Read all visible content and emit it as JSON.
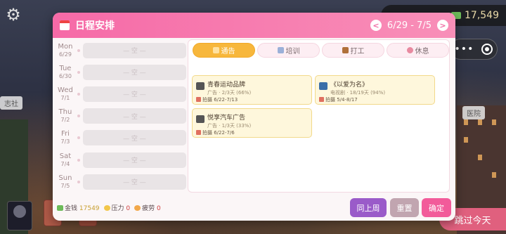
{
  "hud": {
    "money_top": "17,549"
  },
  "side_labels": {
    "left": "志社",
    "right": "医院"
  },
  "skip_button": "跳过今天",
  "dialog": {
    "title": "日程安排",
    "range": "6/29 - 7/5",
    "prev_arrow": "<",
    "next_arrow": ">",
    "days": [
      {
        "name": "Mon",
        "date": "6/29",
        "slot": "— 空 —"
      },
      {
        "name": "Tue",
        "date": "6/30",
        "slot": "— 空 —"
      },
      {
        "name": "Wed",
        "date": "7/1",
        "slot": "— 空 —"
      },
      {
        "name": "Thu",
        "date": "7/2",
        "slot": "— 空 —"
      },
      {
        "name": "Fri",
        "date": "7/3",
        "slot": "— 空 —"
      },
      {
        "name": "Sat",
        "date": "7/4",
        "slot": "— 空 —"
      },
      {
        "name": "Sun",
        "date": "7/5",
        "slot": "— 空 —"
      }
    ],
    "tabs": [
      {
        "label": "通告",
        "active": true,
        "icon_color": "#ffe1a0"
      },
      {
        "label": "培训",
        "active": false,
        "icon_color": "#9bb0d8"
      },
      {
        "label": "打工",
        "active": false,
        "icon_color": "#b0703a"
      },
      {
        "label": "休息",
        "active": false,
        "icon_color": "#e88aa0"
      }
    ],
    "cards": [
      {
        "name": "青春运动品牌",
        "meta": "广告 · 2/3天 (66%)",
        "date": "拍摄 6/22-7/13",
        "icon": "camera-icon"
      },
      {
        "name": "《以爱为名》",
        "meta": "电视剧 · 18/19天 (94%)",
        "date": "拍摄 5/4-8/17",
        "icon": "tv-icon"
      },
      {
        "name": "悦享汽车广告",
        "meta": "广告 · 1/3天 (33%)",
        "date": "拍摄 6/22-7/6",
        "icon": "camera-icon"
      }
    ],
    "stats": {
      "money_label": "金钱",
      "money_value": "17549",
      "stress_label": "压力",
      "stress_value": "0",
      "fatigue_label": "疲劳",
      "fatigue_value": "0"
    },
    "buttons": {
      "prev_week": "同上周",
      "reset": "重置",
      "confirm": "确定"
    }
  }
}
